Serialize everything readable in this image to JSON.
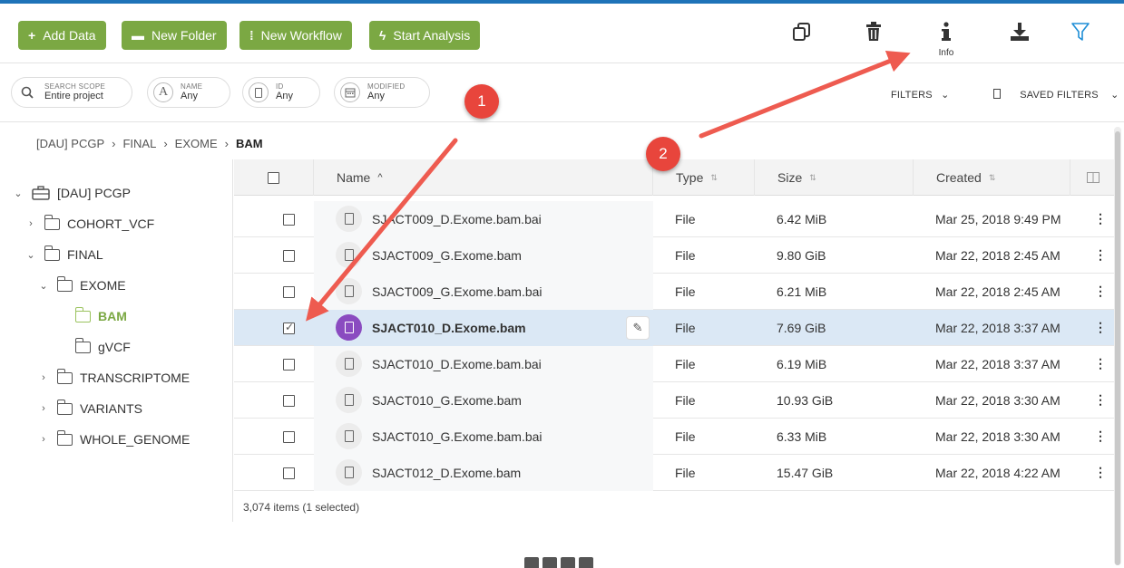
{
  "toolbar": {
    "buttons": [
      {
        "label": "Add Data",
        "icon": "+"
      },
      {
        "label": "New Folder",
        "icon": "folder-icon"
      },
      {
        "label": "New Workflow",
        "icon": "workflow-icon"
      },
      {
        "label": "Start Analysis",
        "icon": "lightning-icon"
      }
    ],
    "tools": {
      "copy_icon": "copy-icon",
      "delete_icon": "trash-icon",
      "info_label": "Info",
      "download_icon": "download-icon",
      "filter_icon": "filter-icon"
    }
  },
  "filters": {
    "search_scope": {
      "label": "SEARCH SCOPE",
      "value": "Entire project"
    },
    "name": {
      "label": "NAME",
      "value": "Any"
    },
    "id": {
      "label": "ID",
      "value": "Any"
    },
    "modified": {
      "label": "MODIFIED",
      "value": "Any"
    },
    "filters_label": "FILTERS",
    "saved_filters_label": "SAVED FILTERS"
  },
  "breadcrumb": [
    "[DAU] PCGP",
    "FINAL",
    "EXOME",
    "BAM"
  ],
  "tree": [
    {
      "label": "[DAU] PCGP",
      "expanded": true
    },
    {
      "label": "COHORT_VCF",
      "expanded": false
    },
    {
      "label": "FINAL",
      "expanded": true
    },
    {
      "label": "EXOME",
      "expanded": true
    },
    {
      "label": "BAM",
      "active": true
    },
    {
      "label": "gVCF"
    },
    {
      "label": "TRANSCRIPTOME",
      "expanded": false
    },
    {
      "label": "VARIANTS",
      "expanded": false
    },
    {
      "label": "WHOLE_GENOME",
      "expanded": false
    }
  ],
  "table": {
    "headers": {
      "name": "Name",
      "type": "Type",
      "size": "Size",
      "created": "Created"
    },
    "rows": [
      {
        "name": "SJACT009_D.Exome.bam.bai",
        "type": "File",
        "size": "6.42 MiB",
        "created": "Mar 25, 2018 9:49 PM",
        "selected": false
      },
      {
        "name": "SJACT009_G.Exome.bam",
        "type": "File",
        "size": "9.80 GiB",
        "created": "Mar 22, 2018 2:45 AM",
        "selected": false
      },
      {
        "name": "SJACT009_G.Exome.bam.bai",
        "type": "File",
        "size": "6.21 MiB",
        "created": "Mar 22, 2018 2:45 AM",
        "selected": false
      },
      {
        "name": "SJACT010_D.Exome.bam",
        "type": "File",
        "size": "7.69 GiB",
        "created": "Mar 22, 2018 3:37 AM",
        "selected": true
      },
      {
        "name": "SJACT010_D.Exome.bam.bai",
        "type": "File",
        "size": "6.19 MiB",
        "created": "Mar 22, 2018 3:37 AM",
        "selected": false
      },
      {
        "name": "SJACT010_G.Exome.bam",
        "type": "File",
        "size": "10.93 GiB",
        "created": "Mar 22, 2018 3:30 AM",
        "selected": false
      },
      {
        "name": "SJACT010_G.Exome.bam.bai",
        "type": "File",
        "size": "6.33 MiB",
        "created": "Mar 22, 2018 3:30 AM",
        "selected": false
      },
      {
        "name": "SJACT012_D.Exome.bam",
        "type": "File",
        "size": "15.47 GiB",
        "created": "Mar 22, 2018 4:22 AM",
        "selected": false
      }
    ],
    "footer": "3,074 items (1 selected)"
  },
  "annotations": {
    "badge1": "1",
    "badge2": "2",
    "color": "#e8453c"
  },
  "colors": {
    "accent": "#7ba843",
    "selected_row": "#dbe8f5",
    "brand_bar": "#1e73b8"
  }
}
